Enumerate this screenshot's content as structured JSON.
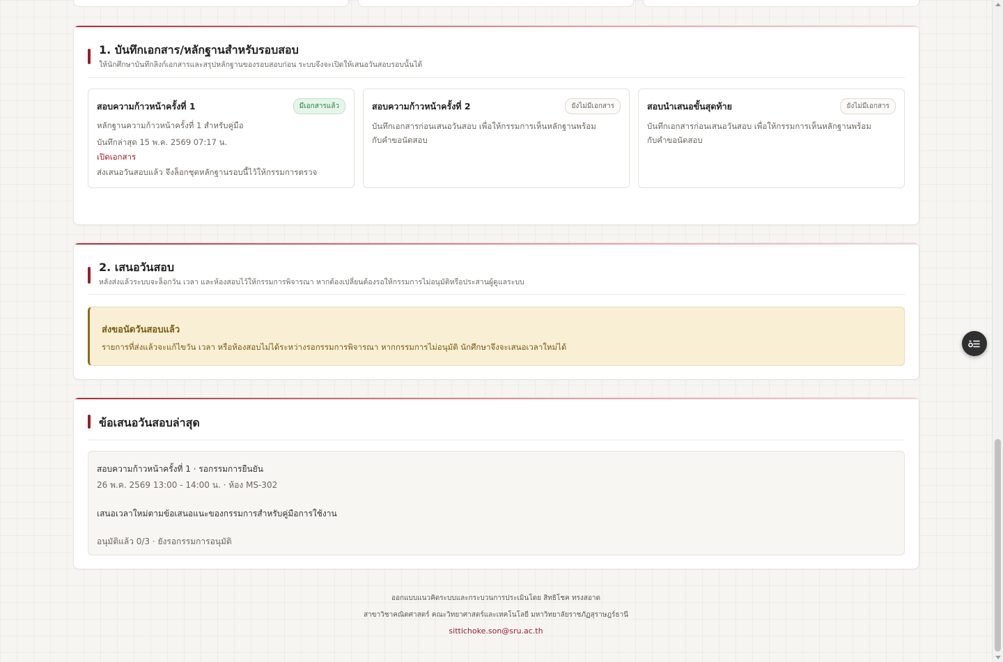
{
  "section_evidence": {
    "title": "1. บันทึกเอกสาร/หลักฐานสำหรับรอบสอบ",
    "subtitle": "ให้นักศึกษาบันทึกลิงก์เอกสารและสรุปหลักฐานของรอบสอบก่อน ระบบจึงจะเปิดให้เสนอวันสอบรอบนั้นได้",
    "rounds": [
      {
        "title": "สอบความก้าวหน้าครั้งที่ 1",
        "badge": "มีเอกสารแล้ว",
        "line1": "หลักฐานความก้าวหน้าครั้งที่ 1 สำหรับคู่มือ",
        "line2": "บันทึกล่าสุด 15 พ.ค. 2569 07:17 น.",
        "link": "เปิดเอกสาร",
        "line3": "ส่งเสนอวันสอบแล้ว จึงล็อกชุดหลักฐานรอบนี้ไว้ให้กรรมการตรวจ"
      },
      {
        "title": "สอบความก้าวหน้าครั้งที่ 2",
        "badge": "ยังไม่มีเอกสาร",
        "line1": "บันทึกเอกสารก่อนเสนอวันสอบ เพื่อให้กรรมการเห็นหลักฐานพร้อม",
        "line2": "กับคำขอนัดสอบ"
      },
      {
        "title": "สอบนำเสนอขั้นสุดท้าย",
        "badge": "ยังไม่มีเอกสาร",
        "line1": "บันทึกเอกสารก่อนเสนอวันสอบ เพื่อให้กรรมการเห็นหลักฐานพร้อม",
        "line2": "กับคำขอนัดสอบ"
      }
    ]
  },
  "section_propose": {
    "title": "2. เสนอวันสอบ",
    "subtitle": "หลังส่งแล้วระบบจะล็อกวัน เวลา และห้องสอบไว้ให้กรรมการพิจารณา หากต้องเปลี่ยนต้องรอให้กรรมการไม่อนุมัติหรือประสานผู้ดูแลระบบ",
    "alert_title": "ส่งขอนัดวันสอบแล้ว",
    "alert_text": "รายการที่ส่งแล้วจะแก้ไขวัน เวลา หรือห้องสอบไม่ได้ระหว่างรอกรรมการพิจารณา หากกรรมการไม่อนุมัติ นักศึกษาจึงจะเสนอเวลาใหม่ได้"
  },
  "section_latest": {
    "title": "ข้อเสนอวันสอบล่าสุด",
    "line1": "สอบความก้าวหน้าครั้งที่ 1 · รอกรรมการยืนยัน",
    "line2": "26 พ.ค. 2569 13:00 - 14:00 น. · ห้อง MS-302",
    "line3": "เสนอเวลาใหม่ตามข้อเสนอแนะของกรรมการสำหรับคู่มือการใช้งาน",
    "line4": "อนุมัติแล้ว 0/3 · ยังรอกรรมการอนุมัติ"
  },
  "footer": {
    "line1": "ออกแบบแนวคิดระบบและกระบวนการประเมินโดย สิทธิโชค ทรงสอาด",
    "line2": "สาขาวิชาคณิตศาสตร์ คณะวิทยาศาสตร์และเทคโนโลยี มหาวิทยาลัยราชภัฏสุราษฎร์ธานี",
    "email": "sittichoke.son@sru.ac.th"
  },
  "icons": {
    "fab": "settings-list-icon"
  },
  "colors": {
    "accent": "#9b1c28",
    "success": "#2c7a43",
    "warning_text": "#7a5a12",
    "warning_bg": "#f8efd5"
  }
}
